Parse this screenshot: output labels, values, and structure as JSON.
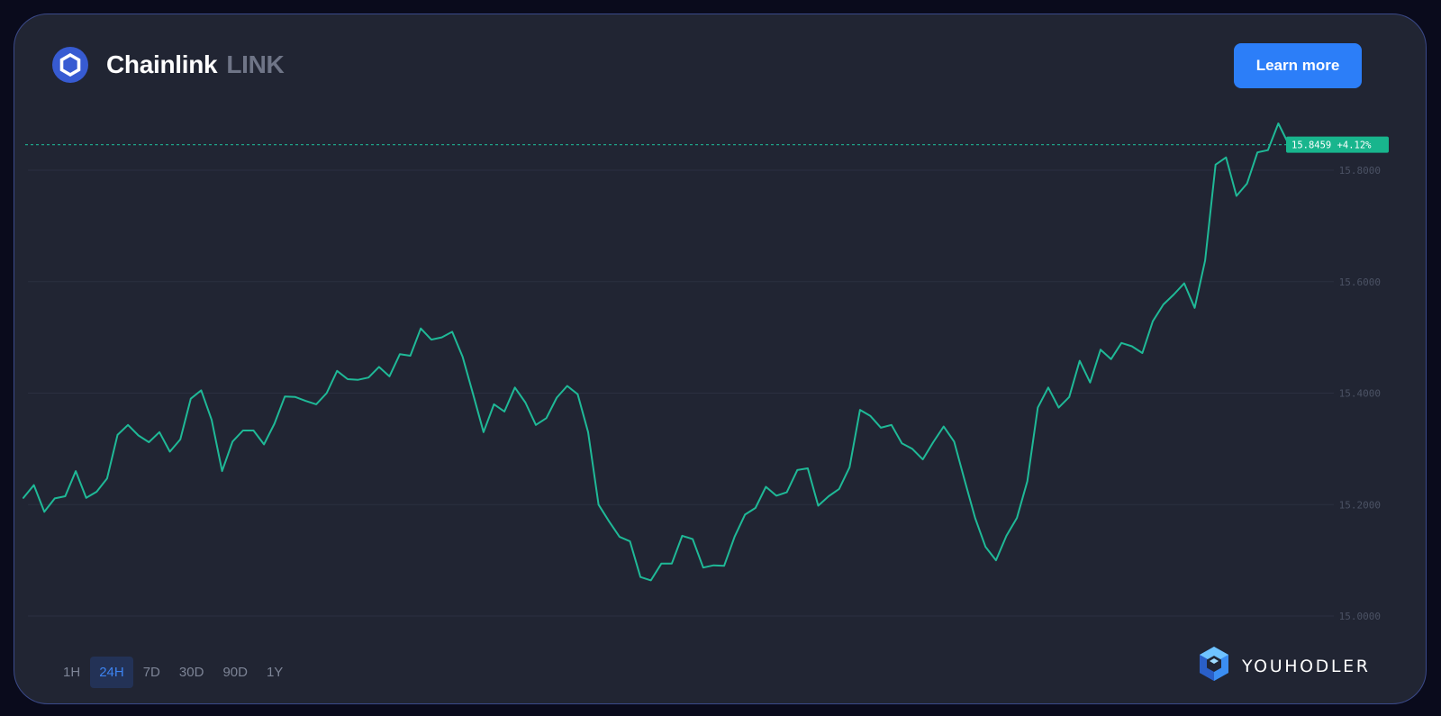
{
  "header": {
    "coin_icon": "chainlink-hexagon-icon",
    "coin_name": "Chainlink",
    "ticker": "LINK"
  },
  "cta": {
    "label": "Learn more"
  },
  "time_ranges": {
    "options": [
      "1H",
      "24H",
      "7D",
      "30D",
      "90D",
      "1Y"
    ],
    "selected": "24H"
  },
  "brand": {
    "logo_icon": "youhodler-cube-icon",
    "name": "YOUHODLER"
  },
  "colors": {
    "background": "#212533",
    "line": "#1fb997",
    "accent": "#2c7ef8",
    "price_badge": "#18b58d",
    "grid": "#2b3040",
    "tick_text": "#4b5264"
  },
  "chart_data": {
    "type": "line",
    "series": [
      {
        "values": [
          15.212,
          15.235,
          15.187,
          15.211,
          15.215,
          15.26,
          15.212,
          15.223,
          15.247,
          15.325,
          15.343,
          15.324,
          15.312,
          15.33,
          15.295,
          15.317,
          15.39,
          15.405,
          15.352,
          15.26,
          15.313,
          15.333,
          15.333,
          15.308,
          15.345,
          15.394,
          15.393,
          15.386,
          15.38,
          15.4,
          15.44,
          15.425,
          15.424,
          15.428,
          15.447,
          15.43,
          15.47,
          15.467,
          15.516,
          15.496,
          15.5,
          15.51,
          15.465,
          15.398,
          15.33,
          15.38,
          15.367,
          15.41,
          15.383,
          15.343,
          15.355,
          15.392,
          15.413,
          15.398,
          15.33,
          15.2,
          15.17,
          15.142,
          15.134,
          15.07,
          15.064,
          15.094,
          15.094,
          15.144,
          15.138,
          15.087,
          15.091,
          15.09,
          15.142,
          15.182,
          15.194,
          15.232,
          15.216,
          15.222,
          15.262,
          15.265,
          15.198,
          15.215,
          15.228,
          15.267,
          15.37,
          15.359,
          15.338,
          15.343,
          15.31,
          15.3,
          15.281,
          15.312,
          15.34,
          15.313,
          15.244,
          15.176,
          15.124,
          15.1,
          15.144,
          15.176,
          15.242,
          15.374,
          15.41,
          15.374,
          15.393,
          15.458,
          15.419,
          15.478,
          15.461,
          15.49,
          15.484,
          15.472,
          15.529,
          15.559,
          15.577,
          15.597,
          15.553,
          15.638,
          15.81,
          15.823,
          15.754,
          15.776,
          15.832,
          15.836,
          15.884,
          15.846
        ]
      }
    ],
    "last_price": "15.8459",
    "change": "+4.12%",
    "y_ticks": [
      "15.0000",
      "15.2000",
      "15.4000",
      "15.6000",
      "15.8000"
    ],
    "ylim": [
      15.0,
      15.8
    ],
    "grid": true
  }
}
